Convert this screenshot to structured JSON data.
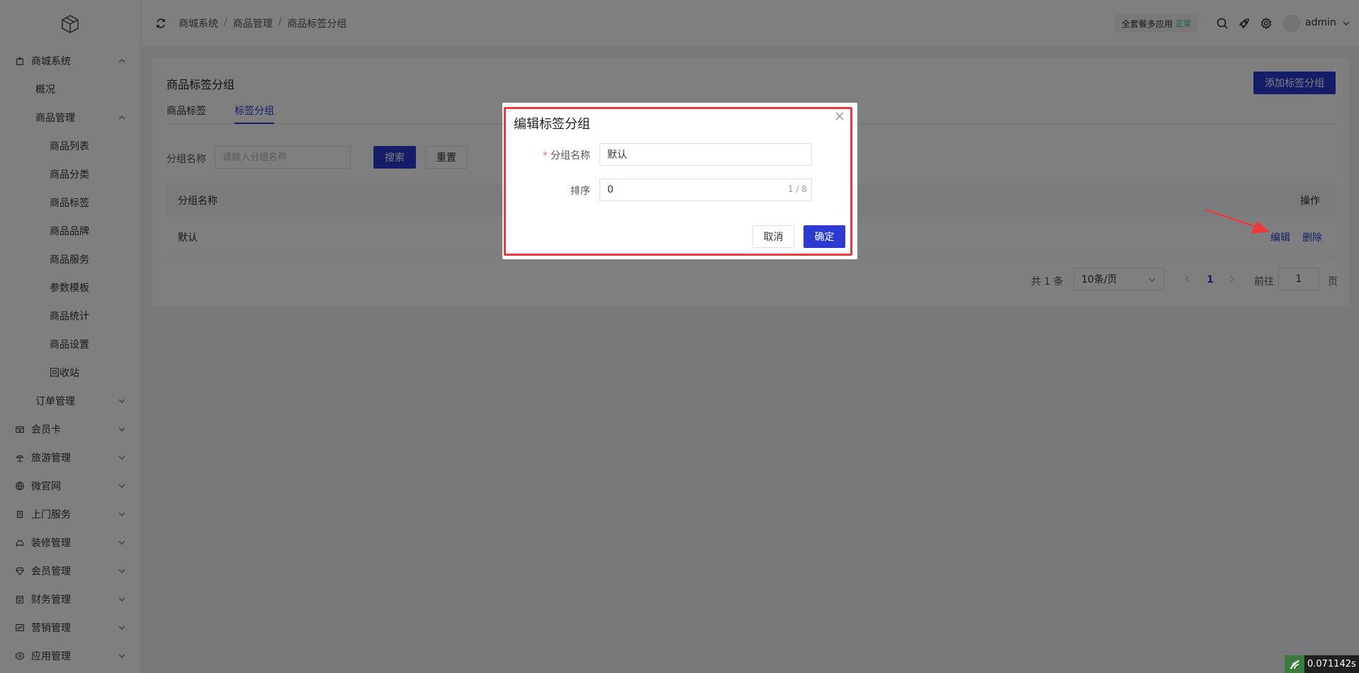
{
  "sidebar": {
    "items": [
      {
        "label": "商城系统",
        "level": 0,
        "icon": "bag-icon",
        "expanded": true
      },
      {
        "label": "概况",
        "level": 1
      },
      {
        "label": "商品管理",
        "level": 1,
        "expanded": true
      },
      {
        "label": "商品列表",
        "level": 2
      },
      {
        "label": "商品分类",
        "level": 2
      },
      {
        "label": "商品标签",
        "level": 2
      },
      {
        "label": "商品品牌",
        "level": 2
      },
      {
        "label": "商品服务",
        "level": 2
      },
      {
        "label": "参数模板",
        "level": 2
      },
      {
        "label": "商品统计",
        "level": 2
      },
      {
        "label": "商品设置",
        "level": 2
      },
      {
        "label": "回收站",
        "level": 2
      },
      {
        "label": "订单管理",
        "level": 1,
        "expanded": false
      },
      {
        "label": "会员卡",
        "level": 0,
        "icon": "card-icon",
        "expanded": false
      },
      {
        "label": "旅游管理",
        "level": 0,
        "icon": "beach-icon",
        "expanded": false
      },
      {
        "label": "微官网",
        "level": 0,
        "icon": "globe-icon",
        "expanded": false
      },
      {
        "label": "上门服务",
        "level": 0,
        "icon": "service-icon",
        "expanded": false
      },
      {
        "label": "装修管理",
        "level": 0,
        "icon": "sofa-icon",
        "expanded": false
      },
      {
        "label": "会员管理",
        "level": 0,
        "icon": "diamond-icon",
        "expanded": false
      },
      {
        "label": "财务管理",
        "level": 0,
        "icon": "finance-icon",
        "expanded": false
      },
      {
        "label": "营销管理",
        "level": 0,
        "icon": "chart-icon",
        "expanded": false
      },
      {
        "label": "应用管理",
        "level": 0,
        "icon": "app-icon",
        "expanded": false
      }
    ]
  },
  "header": {
    "breadcrumb": [
      "商城系统",
      "商品管理",
      "商品标签分组"
    ],
    "breadcrumb_sep": "/",
    "plan_label": "全套餐多应用",
    "plan_status": "正常",
    "username": "admin"
  },
  "page": {
    "title": "商品标签分组",
    "add_button": "添加标签分组",
    "tabs": [
      {
        "label": "商品标签",
        "active": false
      },
      {
        "label": "标签分组",
        "active": true
      }
    ],
    "filter": {
      "label": "分组名称",
      "placeholder": "请输入分组名称",
      "search_button": "搜索",
      "reset_button": "重置"
    },
    "table": {
      "columns": [
        "分组名称",
        "操作"
      ],
      "rows": [
        {
          "name": "默认",
          "actions": [
            "编辑",
            "删除"
          ]
        }
      ]
    },
    "pagination": {
      "total_text": "共 1 条",
      "page_size": "10条/页",
      "current_page": "1",
      "goto_label": "前往",
      "goto_value": "1",
      "page_suffix": "页"
    }
  },
  "dialog": {
    "title": "编辑标签分组",
    "fields": [
      {
        "label": "分组名称",
        "required": true,
        "value": "默认"
      },
      {
        "label": "排序",
        "required": false,
        "value": "0",
        "counter": "1 / 8"
      }
    ],
    "cancel_button": "取消",
    "confirm_button": "确定"
  },
  "timer": {
    "value": "0.071142s"
  },
  "colors": {
    "primary": "#2b3bd1",
    "annotation": "#ee3a3a",
    "status_ok": "#3ac06a"
  }
}
